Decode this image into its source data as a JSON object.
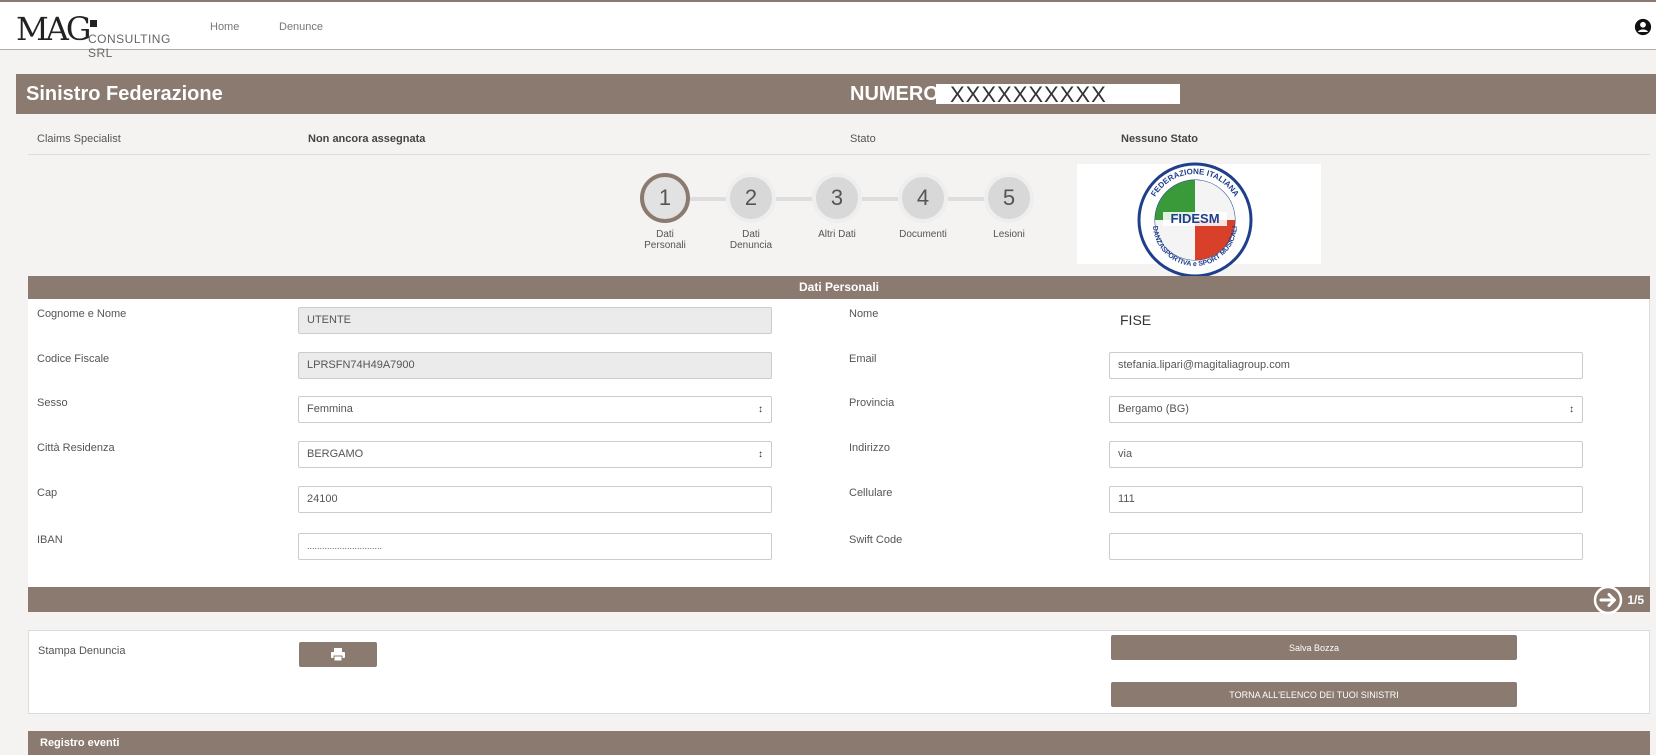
{
  "header": {
    "logo_main": "MAG",
    "logo_sub": "CONSULTING SRL",
    "nav": [
      {
        "label": "Home"
      },
      {
        "label": "Denunce"
      }
    ],
    "user_icon": "user-circle-icon"
  },
  "claim": {
    "title": "Sinistro Federazione",
    "numero_label": "NUMERO",
    "numero_value": "XXXXXXXXXX"
  },
  "info": {
    "specialist_label": "Claims Specialist",
    "specialist_value": "Non ancora assegnata",
    "stato_label": "Stato",
    "stato_value": "Nessuno Stato"
  },
  "steps": [
    {
      "num": "1",
      "label": "Dati\nPersonali",
      "active": true
    },
    {
      "num": "2",
      "label": "Dati\nDenuncia",
      "active": false
    },
    {
      "num": "3",
      "label": "Altri Dati",
      "active": false
    },
    {
      "num": "4",
      "label": "Documenti",
      "active": false
    },
    {
      "num": "5",
      "label": "Lesioni",
      "active": false
    }
  ],
  "badge": {
    "text_top": "FEDERAZIONE ITALIANA",
    "text_bottom": "DANZASPORTIVA e SPORT MUSICALI",
    "center": "FIDESM"
  },
  "section_title": "Dati Personali",
  "form": {
    "cognome_label": "Cognome e Nome",
    "cognome_value": "UTENTE",
    "nome_label": "Nome",
    "nome_value": "FISE",
    "cf_label": "Codice Fiscale",
    "cf_value": "LPRSFN74H49A7900",
    "email_label": "Email",
    "email_value": "stefania.lipari@magitaliagroup.com",
    "sesso_label": "Sesso",
    "sesso_value": "Femmina",
    "provincia_label": "Provincia",
    "provincia_value": "Bergamo (BG)",
    "citta_label": "Città Residenza",
    "citta_value": "BERGAMO",
    "indirizzo_label": "Indirizzo",
    "indirizzo_value": "via",
    "cap_label": "Cap",
    "cap_value": "24100",
    "cellulare_label": "Cellulare",
    "cellulare_value": "111",
    "iban_label": "IBAN",
    "iban_value": "..............................",
    "swift_label": "Swift Code",
    "swift_value": ""
  },
  "pager": {
    "label": "1/5",
    "icon": "arrow-right-circle-icon"
  },
  "actions": {
    "stampa_label": "Stampa Denuncia",
    "print_icon": "printer-icon",
    "salva_label": "Salva Bozza",
    "torna_label": "TORNA ALL'ELENCO DEI TUOI SINISTRI"
  },
  "registro_title": "Registro eventi",
  "colors": {
    "brand": "#8a7a6f"
  }
}
